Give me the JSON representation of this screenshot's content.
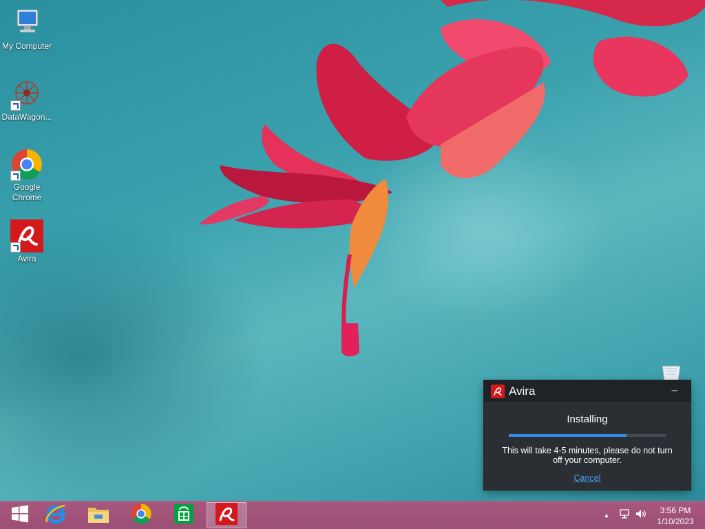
{
  "desktop": {
    "icons": [
      {
        "label": "My Computer",
        "icon": "computer-icon"
      },
      {
        "label": "DataWagon...",
        "icon": "datawagon-icon"
      },
      {
        "label": "Google\nChrome",
        "icon": "chrome-icon"
      },
      {
        "label": "Avira",
        "icon": "avira-icon"
      }
    ]
  },
  "avira_window": {
    "title": "Avira",
    "minimize_label": "–",
    "status": "Installing",
    "progress_fraction": 0.75,
    "message": "This will take 4-5 minutes, please do not turn off your computer.",
    "cancel_label": "Cancel",
    "accent": "#d3191c",
    "progress_color": "#2f8ce0"
  },
  "taskbar": {
    "items": [
      {
        "name": "start-button",
        "icon": "windows-logo-icon"
      },
      {
        "name": "internet-explorer",
        "icon": "internet-explorer-icon"
      },
      {
        "name": "file-explorer",
        "icon": "folder-icon"
      },
      {
        "name": "google-chrome",
        "icon": "chrome-icon"
      },
      {
        "name": "windows-store",
        "icon": "store-icon"
      },
      {
        "name": "avira",
        "icon": "avira-icon",
        "active": true
      }
    ],
    "tray": {
      "icons": [
        "show-hidden-icons-icon",
        "network-icon",
        "volume-icon"
      ],
      "time": "3:56 PM",
      "date": "1/10/2023"
    }
  },
  "colors": {
    "taskbar": "#a8577e",
    "window_background": "#2b2f33"
  }
}
